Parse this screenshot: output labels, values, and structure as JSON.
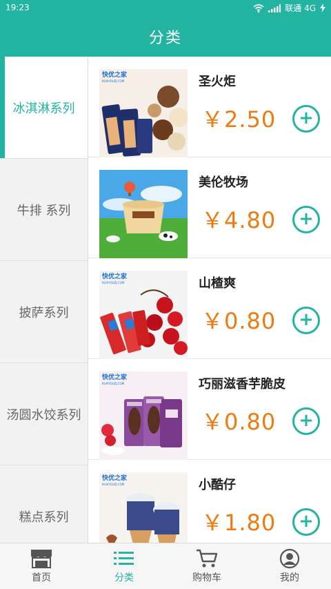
{
  "status_bar": {
    "time": "19:23",
    "carrier": "联通 4G"
  },
  "header": {
    "title": "分类"
  },
  "categories": [
    {
      "label": "冰淇淋系列",
      "active": true
    },
    {
      "label": "牛排 系列",
      "active": false
    },
    {
      "label": "披萨系列",
      "active": false
    },
    {
      "label": "汤圆水饺系列",
      "active": false
    },
    {
      "label": "糕点系列",
      "active": false
    }
  ],
  "products": [
    {
      "name": "圣火炬",
      "price": "￥2.50",
      "image_icon": "chocolate-icecream-image"
    },
    {
      "name": "美伦牧场",
      "price": "￥4.80",
      "image_icon": "meadow-cup-icecream-image"
    },
    {
      "name": "山楂爽",
      "price": "￥0.80",
      "image_icon": "hawthorn-icebar-image"
    },
    {
      "name": "巧丽滋香芋脆皮",
      "price": "￥0.80",
      "image_icon": "taro-crisp-icebar-image"
    },
    {
      "name": "小酷仔",
      "price": "￥1.80",
      "image_icon": "cone-icecream-image"
    }
  ],
  "product_image_text": {
    "brand": "快优之家",
    "brand_url": "KUAIYOUZJ.COM"
  },
  "add_button_symbol": "+",
  "bottom_nav": [
    {
      "label": "首页",
      "icon": "shop-icon",
      "active": false
    },
    {
      "label": "分类",
      "icon": "list-icon",
      "active": true
    },
    {
      "label": "购物车",
      "icon": "cart-icon",
      "active": false
    },
    {
      "label": "我的",
      "icon": "user-icon",
      "active": false
    }
  ],
  "colors": {
    "primary": "#22b4a0",
    "price": "#f07a10"
  }
}
